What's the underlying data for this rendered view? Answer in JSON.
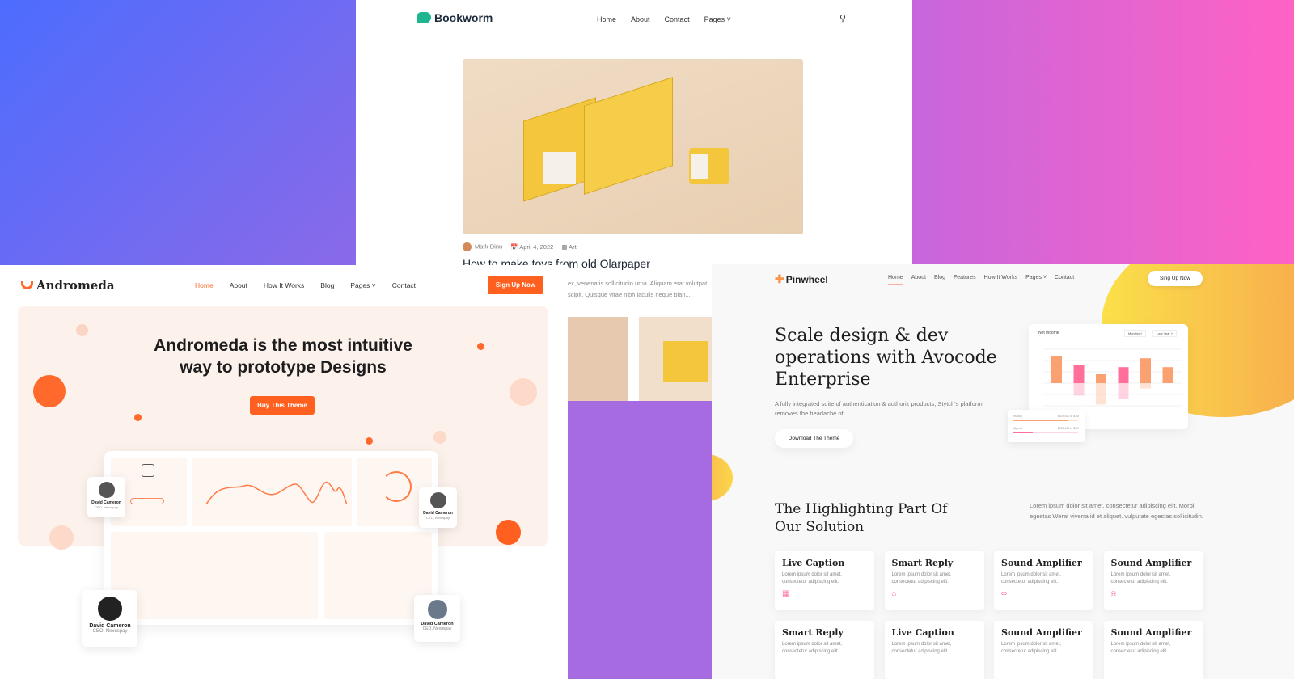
{
  "bookworm": {
    "logo": "Bookworm",
    "nav": [
      "Home",
      "About",
      "Contact",
      "Pages ˅"
    ],
    "post": {
      "author": "Mark Dinn",
      "date": "April 4, 2022",
      "category": "Art",
      "title": "How to make toys from old Olarpaper",
      "excerpt_lines": [
        "ex, venenatis sollicitudin urna. Aliquam erat volutpat.",
        "scipit. Quisque vitae nibh iaculis neque blan..."
      ]
    }
  },
  "andromeda": {
    "logo": "Andromeda",
    "nav": [
      "Home",
      "About",
      "How It Works",
      "Blog",
      "Pages ˅",
      "Contact"
    ],
    "signup": "Sign Up Now",
    "hero_title_line1": "Andromeda is the most intuitive",
    "hero_title_line2": "way to prototype Designs",
    "buy": "Buy This Theme",
    "accent": "#ff5f1f",
    "people": [
      {
        "name": "David Cameron",
        "role": "CEO, Nexuspay"
      },
      {
        "name": "David Cameron",
        "role": "CEO, Nexuspay"
      },
      {
        "name": "David Cameron",
        "role": "CEO, Nexuspay"
      },
      {
        "name": "David Cameron",
        "role": "CEO, Nexuspay"
      }
    ]
  },
  "pinwheel": {
    "logo": "Pinwheel",
    "nav": [
      "Home",
      "About",
      "Blog",
      "Features",
      "How It Works",
      "Pages ˅",
      "Contact"
    ],
    "signup": "Sing Up Now",
    "hero_title": "Scale design & dev operations with Avocode Enterprise",
    "hero_sub": "A fully integrated suite of authentication & authoriz products, Stytch's platform removes the headache of.",
    "download": "Download The Theme",
    "chart": {
      "title": "Net Income",
      "filters": [
        "Monthly ˅",
        "Last Year ˅"
      ],
      "positive": [
        15,
        10,
        5,
        9,
        14,
        9
      ],
      "negative": [
        0,
        -7,
        -12,
        -9,
        -3,
        0
      ],
      "colors": [
        "#fba070",
        "#ff6f99",
        "#fba070",
        "#ff6f99",
        "#fba070",
        "#fba070"
      ]
    },
    "mini": [
      {
        "label": "Russia",
        "value": "$629,510 of $1M",
        "progress": 0.85,
        "color": "#fba070"
      },
      {
        "label": "Algeria",
        "value": "$128,102 of $1M",
        "progress": 0.3,
        "color": "#ff6f99"
      }
    ],
    "section_title": "The Highlighting Part Of Our Solution",
    "section_text": "Lorem ipsum dolor sit amet, consectetur adipiscing elit. Morbi egestas Werat viverra id et aliquet. vulputate egestas sollicitudin.",
    "features": [
      {
        "title": "Live Caption",
        "text": "Lorem ipsum dolor sit amet, consectetur adipiscing elit.",
        "icon": "▦"
      },
      {
        "title": "Smart Reply",
        "text": "Lorem ipsum dolor sit amet, consectetur adipiscing elit.",
        "icon": "⌂"
      },
      {
        "title": "Sound Amplifier",
        "text": "Lorem ipsum dolor sit amet, consectetur adipiscing elit.",
        "icon": "∞"
      },
      {
        "title": "Sound Amplifier",
        "text": "Lorem ipsum dolor sit amet, consectetur adipiscing elit.",
        "icon": "⍾"
      },
      {
        "title": "Smart Reply",
        "text": "Lorem ipsum dolor sit amet, consectetur adipiscing elit.",
        "icon": ""
      },
      {
        "title": "Live Caption",
        "text": "Lorem ipsum dolor sit amet, consectetur adipiscing elit.",
        "icon": ""
      },
      {
        "title": "Sound Amplifier",
        "text": "Lorem ipsum dolor sit amet, consectetur adipiscing elit.",
        "icon": ""
      },
      {
        "title": "Sound Amplifier",
        "text": "Lorem ipsum dolor sit amet, consectetur adipiscing elit.",
        "icon": ""
      }
    ]
  }
}
